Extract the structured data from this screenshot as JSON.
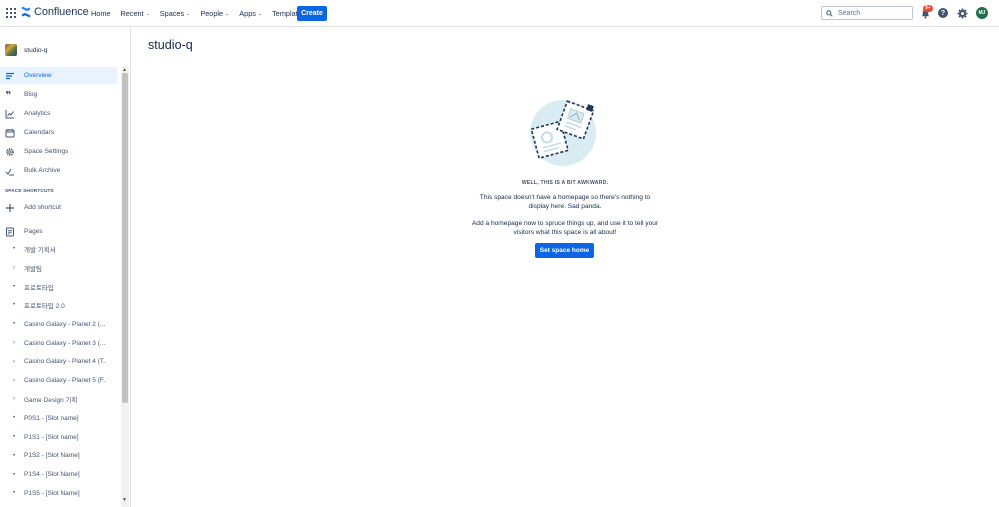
{
  "topnav": {
    "logo_text": "Confluence",
    "items": [
      {
        "label": "Home",
        "chevron": false
      },
      {
        "label": "Recent",
        "chevron": true
      },
      {
        "label": "Spaces",
        "chevron": true
      },
      {
        "label": "People",
        "chevron": true
      },
      {
        "label": "Apps",
        "chevron": true
      },
      {
        "label": "Templates",
        "chevron": false
      }
    ],
    "create_label": "Create",
    "search_placeholder": "Search",
    "notification_badge": "9+",
    "avatar_initials": "MJ"
  },
  "sidebar": {
    "space_name": "studio-q",
    "nav": [
      {
        "label": "Overview",
        "icon": "overview-icon",
        "active": true
      },
      {
        "label": "Blog",
        "icon": "quote-icon",
        "active": false
      },
      {
        "label": "Analytics",
        "icon": "analytics-icon",
        "active": false
      },
      {
        "label": "Calendars",
        "icon": "calendar-icon",
        "active": false
      },
      {
        "label": "Space Settings",
        "icon": "gear-icon",
        "active": false
      },
      {
        "label": "Bulk Archive",
        "icon": "archive-icon",
        "active": false
      }
    ],
    "shortcuts_title": "SPACE SHORTCUTS",
    "add_shortcut_label": "Add shortcut",
    "pages_label": "Pages",
    "pages": [
      {
        "label": "개발 기획서",
        "marker": "•"
      },
      {
        "label": "개발팀",
        "marker": "›"
      },
      {
        "label": "프로토타입",
        "marker": "•"
      },
      {
        "label": "프로토타입 2.0",
        "marker": "•"
      },
      {
        "label": "Casino Galaxy - Planet 2 (...",
        "marker": "•"
      },
      {
        "label": "Casino Galaxy - Planet 3 (...",
        "marker": "›"
      },
      {
        "label": "Casino Galaxy - Planet 4 (T...",
        "marker": "›"
      },
      {
        "label": "Casino Galaxy - Planet 5 (F...",
        "marker": "›"
      },
      {
        "label": "Game Design 기획",
        "marker": "›"
      },
      {
        "label": "P0S1 - [Slot name]",
        "marker": "•"
      },
      {
        "label": "P1S1 - [Slot name]",
        "marker": "•"
      },
      {
        "label": "P1S2 - [Slot Name]",
        "marker": "•"
      },
      {
        "label": "P1S4 - [Slot Name]",
        "marker": "•"
      },
      {
        "label": "P1S5 - [Slot Name]",
        "marker": "•"
      }
    ]
  },
  "main": {
    "title": "studio-q",
    "empty_heading": "WELL, THIS IS A BIT AWKWARD.",
    "empty_p1": "This space doesn't have a homepage so there's nothing to display here. Sad panda.",
    "empty_p2": "Add a homepage now to spruce things up, and use it to tell your visitors what this space is all about!",
    "set_home_label": "Set space home"
  },
  "colors": {
    "primary": "#0c66e4",
    "active_bg": "#e9f2ff",
    "badge": "#e34935",
    "avatar": "#216e4e"
  }
}
